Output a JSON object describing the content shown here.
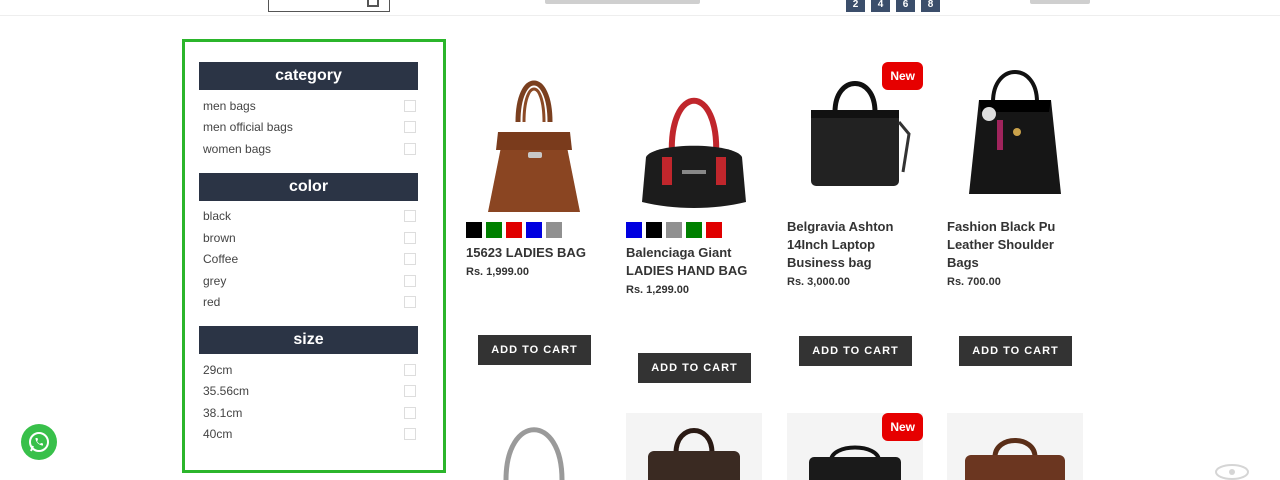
{
  "header": {
    "pager": [
      "2",
      "4",
      "6",
      "8"
    ]
  },
  "sidebar": {
    "category": {
      "title": "category",
      "items": [
        "men bags",
        "men official bags",
        "women bags"
      ]
    },
    "color": {
      "title": "color",
      "items": [
        "black",
        "brown",
        "Coffee",
        "grey",
        "red"
      ]
    },
    "size": {
      "title": "size",
      "items": [
        "29cm",
        "35.56cm",
        "38.1cm",
        "40cm"
      ]
    }
  },
  "products": [
    {
      "name": "15623 LADIES BAG",
      "price": "Rs. 1,999.00",
      "button": "ADD TO CART",
      "badge": "",
      "swatches": [
        "#000000",
        "#008000",
        "#e00000",
        "#0000e0",
        "#909090"
      ]
    },
    {
      "name": "Balenciaga Giant LADIES HAND BAG",
      "price": "Rs. 1,299.00",
      "button": "ADD TO CART",
      "badge": "",
      "swatches": [
        "#0000e0",
        "#000000",
        "#909090",
        "#008000",
        "#e00000"
      ]
    },
    {
      "name": "Belgravia Ashton 14Inch Laptop Business bag",
      "price": "Rs. 3,000.00",
      "button": "ADD TO CART",
      "badge": "New",
      "swatches": []
    },
    {
      "name": "Fashion Black Pu Leather Shoulder Bags",
      "price": "Rs. 700.00",
      "button": "ADD TO CART",
      "badge": "",
      "swatches": []
    }
  ],
  "row2": {
    "badge": "New"
  },
  "colors": {
    "filter_header": "#2b3445",
    "sidebar_border": "#2bb52b",
    "badge": "#e60000",
    "button": "#333333",
    "pager": "#3b4e6b",
    "whatsapp": "#38c04a"
  },
  "icons": {
    "whatsapp": "whatsapp-icon",
    "search": "search-icon"
  }
}
